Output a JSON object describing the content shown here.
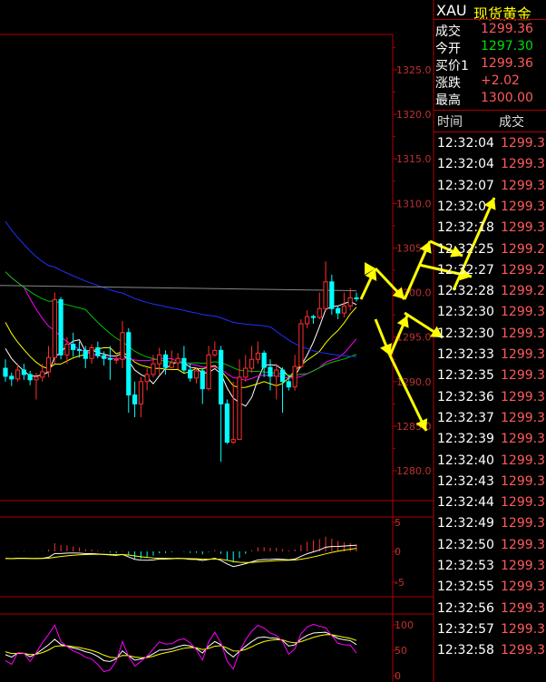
{
  "instrument": {
    "symbol": "XAU",
    "name": "现货黄金"
  },
  "quote": [
    {
      "label": "成交",
      "value": "1299.36",
      "color": "#ff5a5a"
    },
    {
      "label": "今开",
      "value": "1297.30",
      "color": "#00e000"
    },
    {
      "label": "买价1",
      "value": "1299.36",
      "color": "#ff5a5a"
    },
    {
      "label": "涨跌",
      "value": "+2.02",
      "color": "#ff5a5a"
    },
    {
      "label": "最高",
      "value": "1300.00",
      "color": "#ff5a5a"
    }
  ],
  "ticks": {
    "header_time": "时间",
    "header_price": "成交",
    "rows": [
      {
        "time": "12:32:04",
        "price": "1299.3"
      },
      {
        "time": "12:32:04",
        "price": "1299.3"
      },
      {
        "time": "12:32:07",
        "price": "1299.3"
      },
      {
        "time": "12:32:0",
        "price": "1299.3"
      },
      {
        "time": "12:32:18",
        "price": "1299.3"
      },
      {
        "time": "12:32:25",
        "price": "1299.2"
      },
      {
        "time": "12:32:27",
        "price": "1299.2"
      },
      {
        "time": "12:32:28",
        "price": "1299.2"
      },
      {
        "time": "12:32:30",
        "price": "1299.3"
      },
      {
        "time": "12:32:30",
        "price": "1299.3"
      },
      {
        "time": "12:32:33",
        "price": "1299.3"
      },
      {
        "time": "12:32:35",
        "price": "1299.3"
      },
      {
        "time": "12:32:36",
        "price": "1299.3"
      },
      {
        "time": "12:32:37",
        "price": "1299.3"
      },
      {
        "time": "12:32:39",
        "price": "1299.3"
      },
      {
        "time": "12:32:40",
        "price": "1299.3"
      },
      {
        "time": "12:32:43",
        "price": "1299.3"
      },
      {
        "time": "12:32:44",
        "price": "1299.3"
      },
      {
        "time": "12:32:49",
        "price": "1299.3"
      },
      {
        "time": "12:32:50",
        "price": "1299.3"
      },
      {
        "time": "12:32:53",
        "price": "1299.3"
      },
      {
        "time": "12:32:55",
        "price": "1299.3"
      },
      {
        "time": "12:32:56",
        "price": "1299.3"
      },
      {
        "time": "12:32:57",
        "price": "1299.3"
      },
      {
        "time": "12:32:58",
        "price": "1299.3"
      }
    ]
  },
  "colors": {
    "up": "#ff3030",
    "down": "#00ffff",
    "grid": "#b00000",
    "axis_text": "#c03030",
    "arrow": "#ffff00"
  },
  "chart_data": {
    "type": "candlestick",
    "price_axis": {
      "ticks": [
        "1325.0",
        "1320.0",
        "1315.0",
        "1310.0",
        "1305.0",
        "1300.0",
        "1295.0",
        "1290.0",
        "1285.0",
        "1280.0"
      ],
      "range": [
        1277,
        1327
      ]
    },
    "macd_axis": {
      "ticks": [
        "5",
        "0",
        "-5"
      ]
    },
    "kdj_axis": {
      "ticks": [
        "100",
        "50",
        "0"
      ]
    },
    "candles": [
      [
        1291.5,
        1290.6,
        1292.5,
        1290
      ],
      [
        1290.6,
        1290.3,
        1291,
        1289.5
      ],
      [
        1290.3,
        1291.3,
        1292,
        1290
      ],
      [
        1291.3,
        1290.8,
        1292,
        1290.2
      ],
      [
        1290.8,
        1290.2,
        1291.2,
        1289.6
      ],
      [
        1290.2,
        1290.5,
        1291,
        1288
      ],
      [
        1290.5,
        1291.1,
        1292,
        1290
      ],
      [
        1291.1,
        1292.7,
        1294,
        1290.5
      ],
      [
        1292.7,
        1299.2,
        1300,
        1292
      ],
      [
        1299.2,
        1293,
        1299.5,
        1292.5
      ],
      [
        1293,
        1294.2,
        1295,
        1292
      ],
      [
        1294.2,
        1293.6,
        1295.5,
        1292.8
      ],
      [
        1293.6,
        1293.5,
        1294.5,
        1292.7
      ],
      [
        1293.5,
        1292.6,
        1294,
        1291.5
      ],
      [
        1292.6,
        1293.8,
        1294.2,
        1292
      ],
      [
        1293.8,
        1292.9,
        1294.5,
        1292.6
      ],
      [
        1292.9,
        1292.6,
        1293.4,
        1291.8
      ],
      [
        1292.6,
        1292.5,
        1294,
        1290.2
      ],
      [
        1292.5,
        1292.5,
        1293,
        1292
      ],
      [
        1292.5,
        1295.5,
        1296.8,
        1291.5
      ],
      [
        1295.5,
        1288.5,
        1296,
        1286.5
      ],
      [
        1288.5,
        1287.5,
        1290,
        1286
      ],
      [
        1287.5,
        1290,
        1290.5,
        1286
      ],
      [
        1290,
        1290.8,
        1291.5,
        1289
      ],
      [
        1290.8,
        1292,
        1293,
        1290.5
      ],
      [
        1292,
        1293,
        1293.8,
        1290.8
      ],
      [
        1293,
        1291.6,
        1293.5,
        1290.8
      ],
      [
        1291.6,
        1292.1,
        1293.5,
        1291.5
      ],
      [
        1292.1,
        1292.6,
        1293.2,
        1291.4
      ],
      [
        1292.6,
        1291.3,
        1294,
        1291
      ],
      [
        1291.3,
        1290.4,
        1292,
        1290
      ],
      [
        1290.4,
        1291.2,
        1291.5,
        1289.8
      ],
      [
        1291.2,
        1289.2,
        1291.5,
        1287.5
      ],
      [
        1289.2,
        1293,
        1294,
        1289
      ],
      [
        1293,
        1293.5,
        1294.5,
        1292.8
      ],
      [
        1293.5,
        1287.5,
        1294,
        1281
      ],
      [
        1287.5,
        1283.2,
        1288,
        1283
      ],
      [
        1283.2,
        1283.5,
        1290,
        1283
      ],
      [
        1283.5,
        1290.5,
        1292.5,
        1289
      ],
      [
        1290.5,
        1291.5,
        1293,
        1290
      ],
      [
        1291.5,
        1292.5,
        1294,
        1291
      ],
      [
        1292.5,
        1293.2,
        1294.5,
        1292
      ],
      [
        1293.2,
        1291.6,
        1293.5,
        1290.5
      ],
      [
        1291.6,
        1290.6,
        1292.5,
        1289
      ],
      [
        1290.6,
        1291.3,
        1292,
        1288
      ],
      [
        1291.3,
        1290,
        1291.6,
        1286.5
      ],
      [
        1290,
        1289.4,
        1290.5,
        1289
      ],
      [
        1289.4,
        1291.7,
        1293,
        1289
      ],
      [
        1291.7,
        1296.5,
        1297,
        1291.5
      ],
      [
        1296.5,
        1297.3,
        1298,
        1296
      ],
      [
        1297.3,
        1297.2,
        1297.5,
        1296.5
      ],
      [
        1297.2,
        1298.2,
        1300,
        1297
      ],
      [
        1298.2,
        1301.2,
        1303.5,
        1298
      ],
      [
        1301.2,
        1298.2,
        1302,
        1297.5
      ],
      [
        1298.2,
        1297.7,
        1298.5,
        1297
      ],
      [
        1297.7,
        1298.5,
        1300,
        1297.2
      ],
      [
        1298.5,
        1299.4,
        1300.5,
        1298
      ],
      [
        1299.4,
        1299.36,
        1300,
        1299
      ]
    ]
  }
}
